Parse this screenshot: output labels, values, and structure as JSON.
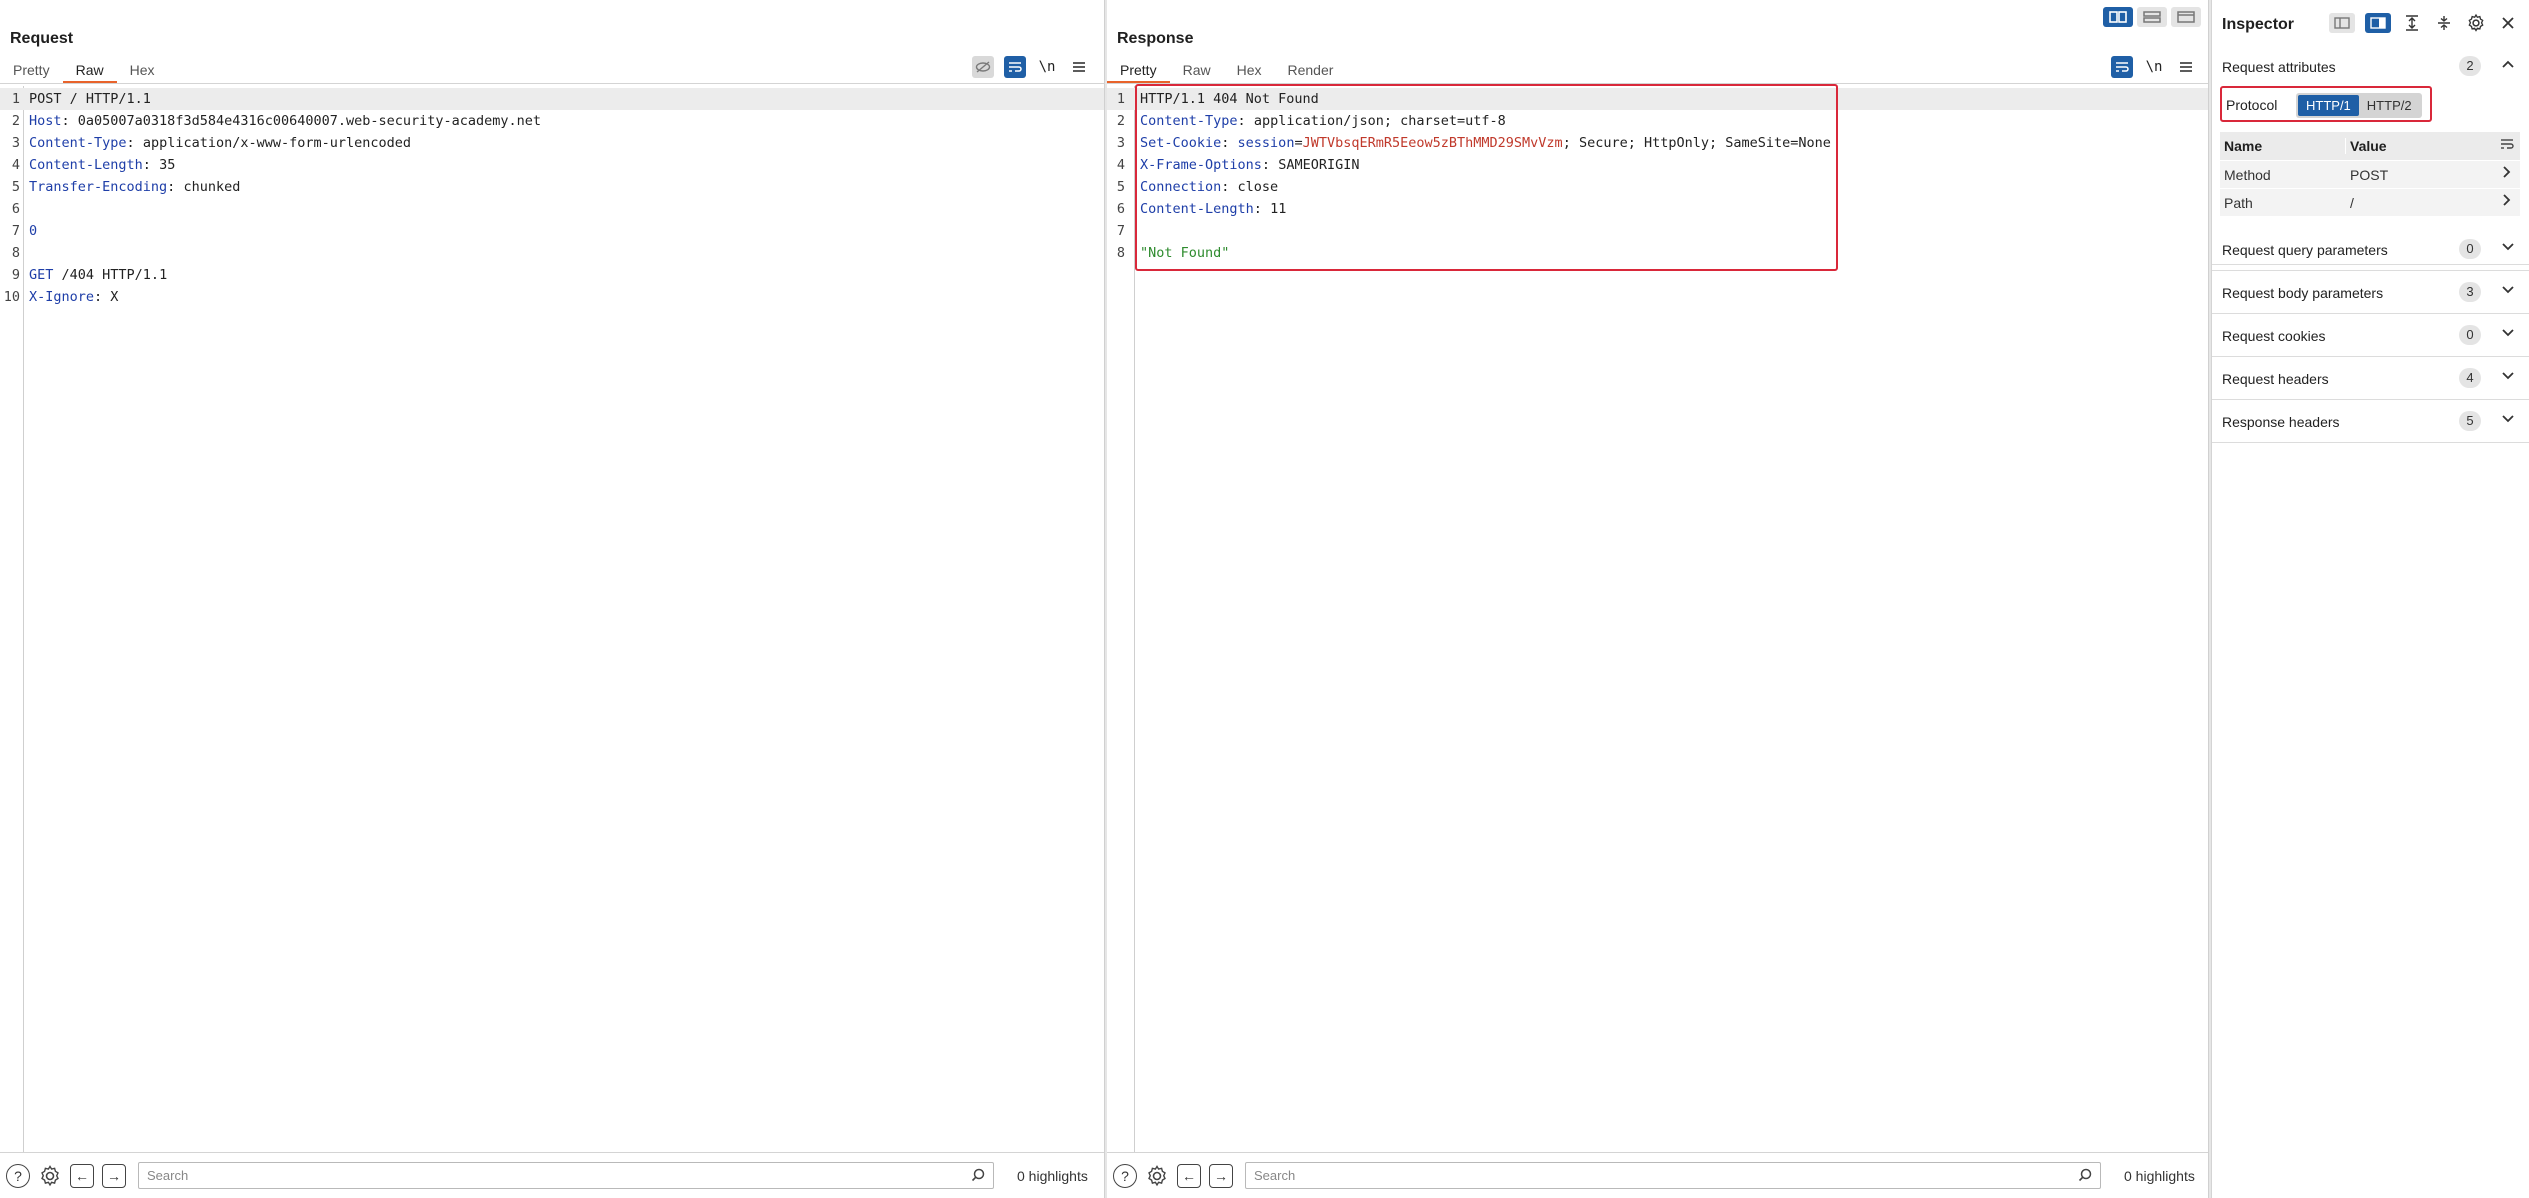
{
  "request": {
    "title": "Request",
    "tabs": [
      {
        "label": "Pretty",
        "active": false
      },
      {
        "label": "Raw",
        "active": true
      },
      {
        "label": "Hex",
        "active": false
      }
    ],
    "newline_toggle": "\\n",
    "lines": [
      {
        "n": "1",
        "key": "",
        "sep": "",
        "value": "POST / HTTP/1.1"
      },
      {
        "n": "2",
        "key": "Host",
        "sep": ": ",
        "value": "0a05007a0318f3d584e4316c00640007.web-security-academy.net"
      },
      {
        "n": "3",
        "key": "Content-Type",
        "sep": ": ",
        "value": "application/x-www-form-urlencoded"
      },
      {
        "n": "4",
        "key": "Content-Length",
        "sep": ": ",
        "value": "35"
      },
      {
        "n": "5",
        "key": "Transfer-Encoding",
        "sep": ": ",
        "value": "chunked"
      },
      {
        "n": "6",
        "key": "",
        "sep": "",
        "value": ""
      },
      {
        "n": "7",
        "key": "0",
        "sep": "",
        "value": ""
      },
      {
        "n": "8",
        "key": "",
        "sep": "",
        "value": ""
      },
      {
        "n": "9",
        "key": "GET",
        "sep": " ",
        "value": "/404 HTTP/1.1"
      },
      {
        "n": "10",
        "key": "X-Ignore",
        "sep": ": ",
        "value": "X"
      }
    ],
    "search_placeholder": "Search",
    "highlights": "0 highlights"
  },
  "response": {
    "title": "Response",
    "tabs": [
      {
        "label": "Pretty",
        "active": true
      },
      {
        "label": "Raw",
        "active": false
      },
      {
        "label": "Hex",
        "active": false
      },
      {
        "label": "Render",
        "active": false
      }
    ],
    "newline_toggle": "\\n",
    "lines": [
      {
        "n": "1",
        "key": "",
        "sep": "",
        "value": "HTTP/1.1 404 Not Found"
      },
      {
        "n": "2",
        "key": "Content-Type",
        "sep": ": ",
        "value": "application/json; charset=utf-8"
      },
      {
        "n": "3",
        "key": "Set-Cookie",
        "sep": ": ",
        "value": ""
      },
      {
        "n": "4",
        "key": "X-Frame-Options",
        "sep": ": ",
        "value": "SAMEORIGIN"
      },
      {
        "n": "5",
        "key": "Connection",
        "sep": ": ",
        "value": "close"
      },
      {
        "n": "6",
        "key": "Content-Length",
        "sep": ": ",
        "value": "11"
      },
      {
        "n": "7",
        "key": "",
        "sep": "",
        "value": ""
      },
      {
        "n": "8",
        "key": "",
        "sep": "",
        "value": ""
      }
    ],
    "cookie": {
      "name": "session",
      "eq": "=",
      "value": "JWTVbsqERmR5Eeow5zBThMMD29SMvVzm",
      "attrs": "; Secure; HttpOnly; SameSite=None"
    },
    "body_string": "\"Not Found\"",
    "search_placeholder": "Search",
    "highlights": "0 highlights"
  },
  "inspector": {
    "title": "Inspector",
    "request_attributes": {
      "label": "Request attributes",
      "count": "2",
      "protocol_label": "Protocol",
      "protocol_options": [
        {
          "label": "HTTP/1",
          "selected": true
        },
        {
          "label": "HTTP/2",
          "selected": false
        }
      ],
      "table_headers": {
        "name": "Name",
        "value": "Value"
      },
      "rows": [
        {
          "name": "Method",
          "value": "POST"
        },
        {
          "name": "Path",
          "value": "/"
        }
      ]
    },
    "sections": [
      {
        "label": "Request query parameters",
        "count": "0"
      },
      {
        "label": "Request body parameters",
        "count": "3"
      },
      {
        "label": "Request cookies",
        "count": "0"
      },
      {
        "label": "Request headers",
        "count": "4"
      },
      {
        "label": "Response headers",
        "count": "5"
      }
    ]
  },
  "colors": {
    "accent_blue": "#1f5fa6",
    "tab_orange": "#e8632b",
    "highlight_red": "#d9283a",
    "header_key_blue": "#1e3ea8",
    "cookie_red": "#c0392b",
    "string_green": "#2e8b2e"
  }
}
